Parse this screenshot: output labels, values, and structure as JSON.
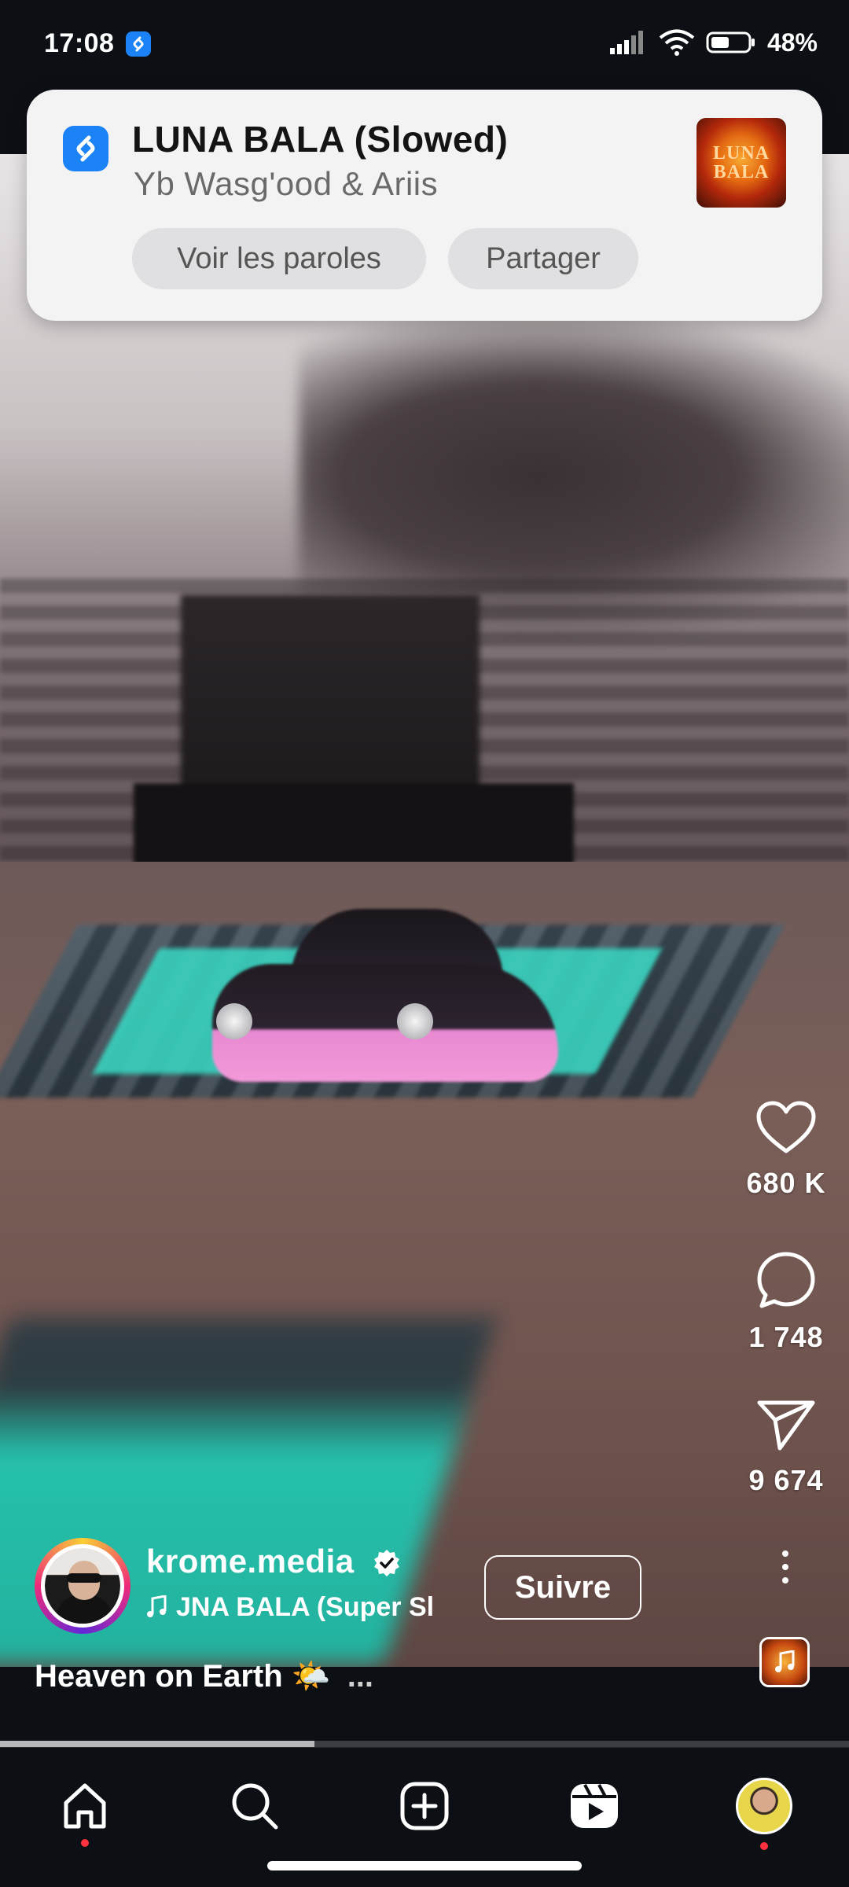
{
  "status_bar": {
    "time": "17:08",
    "battery": "48%"
  },
  "notification": {
    "title": "LUNA BALA (Slowed)",
    "artist": "Yb Wasg'ood & Ariis",
    "cover_text": "LUNA BALA",
    "buttons": {
      "lyrics": "Voir les paroles",
      "share": "Partager"
    }
  },
  "actions": {
    "likes": "680 K",
    "comments": "1 748",
    "shares": "9 674"
  },
  "author": {
    "username": "krome.media",
    "follow_label": "Suivre",
    "audio": "JNA BALA (Super Sl"
  },
  "caption": {
    "text": "Heaven on Earth 🌤️",
    "more": "..."
  },
  "progress": {
    "fraction": 0.37
  },
  "colors": {
    "accent_blue": "#1b83f6",
    "notification_dot": "#ff3040",
    "teal_mat": "#39d2be",
    "car_pink": "#f39ad9"
  },
  "nav": [
    "home-icon",
    "search-icon",
    "create-icon",
    "reels-icon",
    "profile-avatar"
  ]
}
